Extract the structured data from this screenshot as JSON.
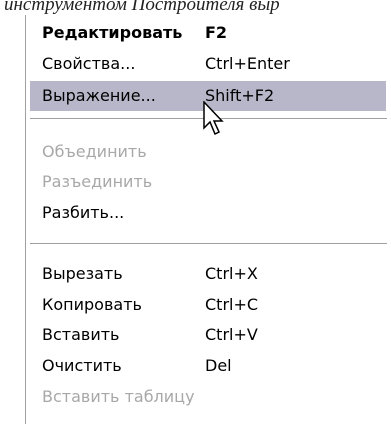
{
  "background_text": "инструментом Построителя выр",
  "context_menu": {
    "items": [
      {
        "label": "Редактировать",
        "shortcut": "F2",
        "bold": true,
        "disabled": false,
        "highlighted": false
      },
      {
        "label": "Свойства...",
        "shortcut": "Ctrl+Enter",
        "bold": false,
        "disabled": false,
        "highlighted": false
      },
      {
        "label": "Выражение...",
        "shortcut": "Shift+F2",
        "bold": false,
        "disabled": false,
        "highlighted": true
      },
      {
        "label": "Объединить",
        "shortcut": "",
        "bold": false,
        "disabled": true,
        "highlighted": false
      },
      {
        "label": "Разъединить",
        "shortcut": "",
        "bold": false,
        "disabled": true,
        "highlighted": false
      },
      {
        "label": "Разбить...",
        "shortcut": "",
        "bold": false,
        "disabled": false,
        "highlighted": false
      },
      {
        "label": "Вырезать",
        "shortcut": "Ctrl+X",
        "bold": false,
        "disabled": false,
        "highlighted": false
      },
      {
        "label": "Копировать",
        "shortcut": "Ctrl+C",
        "bold": false,
        "disabled": false,
        "highlighted": false
      },
      {
        "label": "Вставить",
        "shortcut": "Ctrl+V",
        "bold": false,
        "disabled": false,
        "highlighted": false
      },
      {
        "label": "Очистить",
        "shortcut": "Del",
        "bold": false,
        "disabled": false,
        "highlighted": false
      },
      {
        "label": "Вставить таблицу",
        "shortcut": "",
        "bold": false,
        "disabled": true,
        "highlighted": false
      }
    ]
  },
  "colors": {
    "highlight": "#b8b7c9",
    "disabled_text": "#a8a8a8",
    "separator": "#a0a0a0"
  }
}
